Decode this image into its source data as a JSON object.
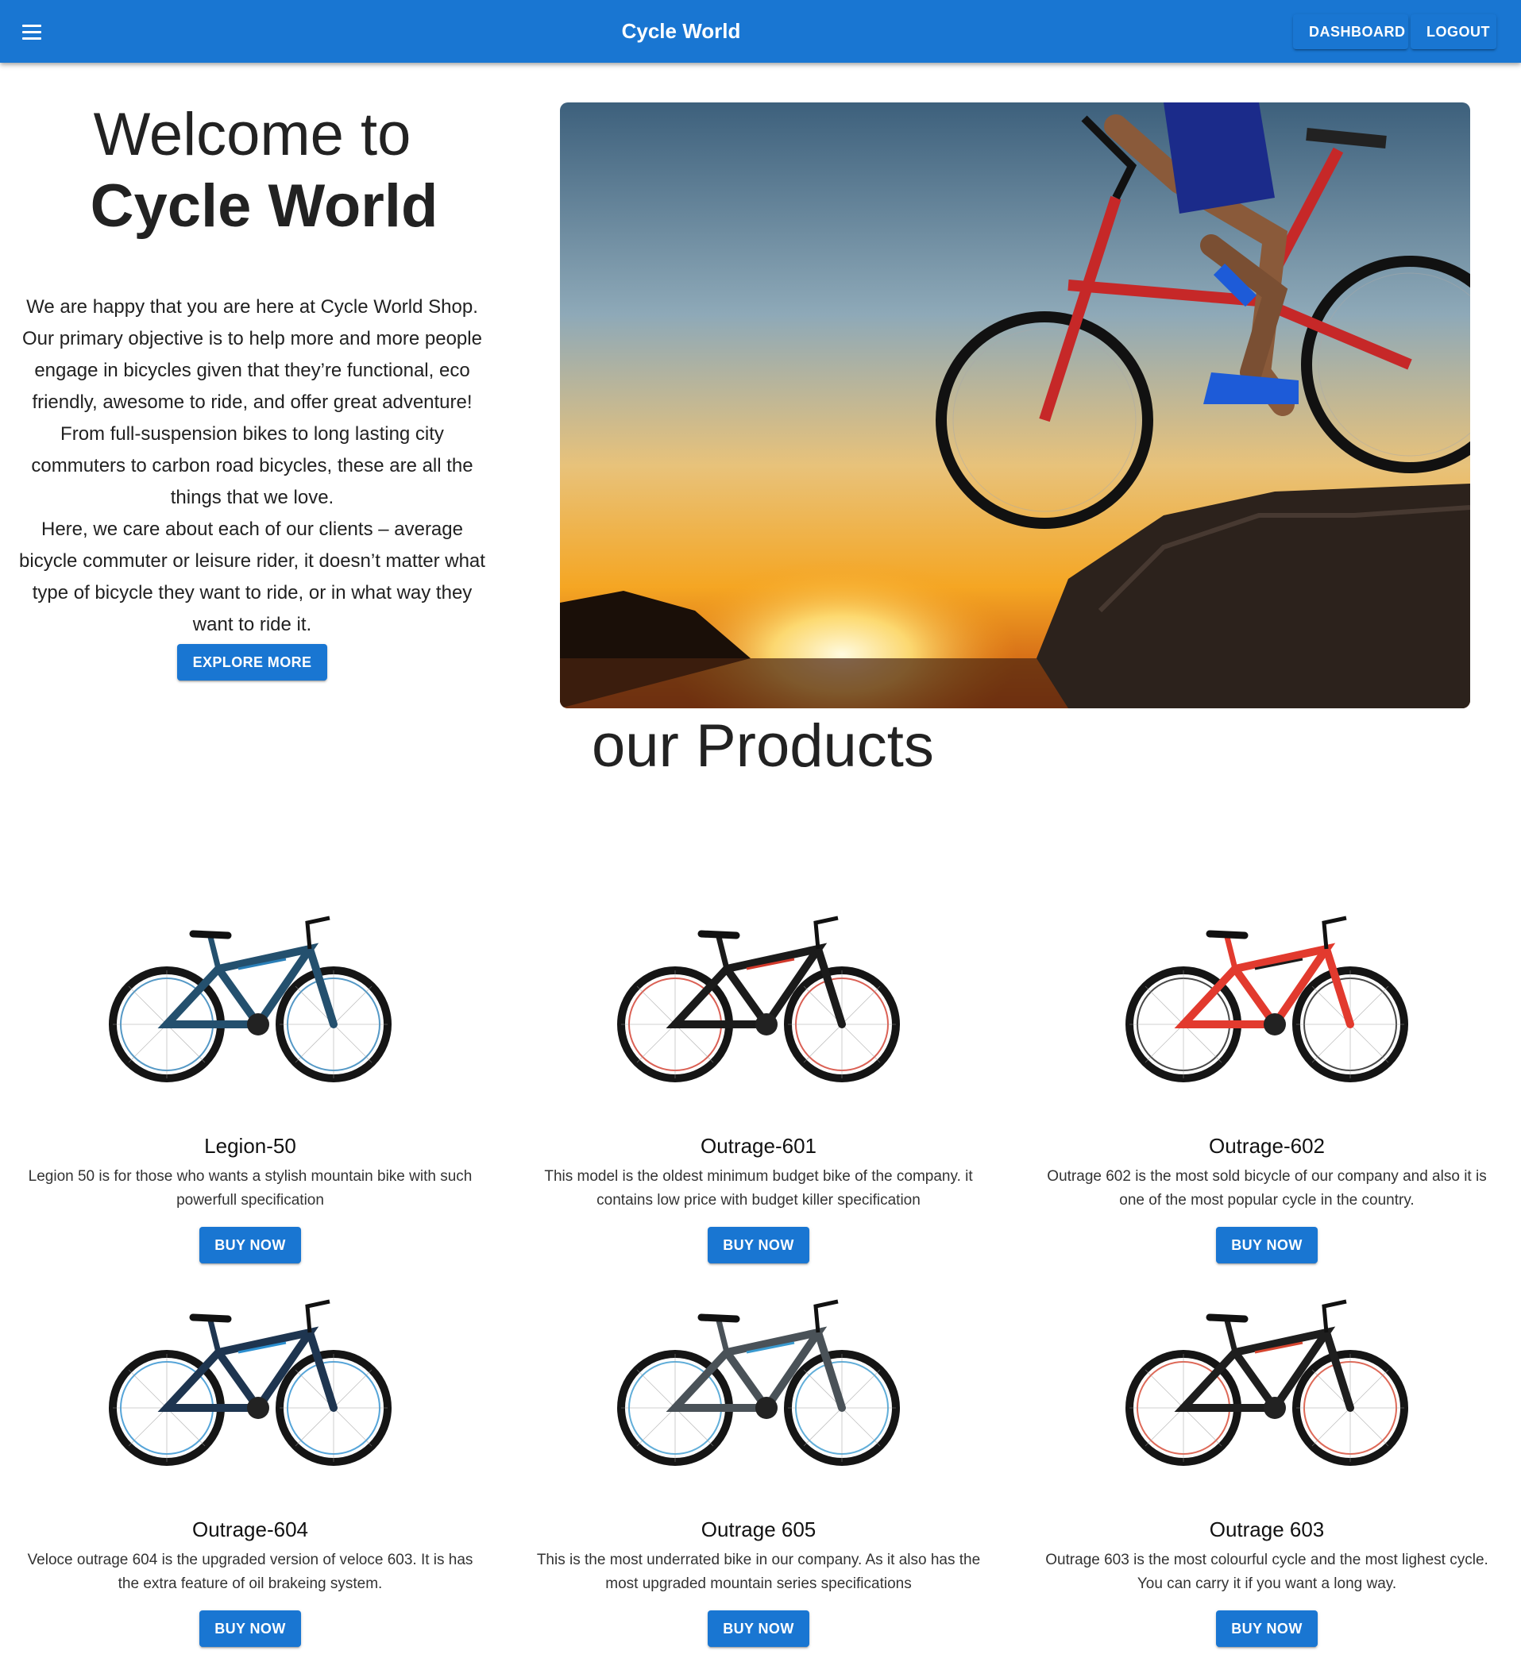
{
  "appbar": {
    "title": "Cycle World",
    "menu_icon": "hamburger-menu-icon",
    "dashboard_label": "DASHBOARD",
    "logout_label": "LOGOUT",
    "color": "#1976d2"
  },
  "hero": {
    "welcome": "Welcome to",
    "brand": "Cycle World",
    "intro": "We are happy that you are here at Cycle World Shop. Our primary objective is to help more and more people engage in bicycles given that they’re functional, eco friendly, awesome to ride, and offer great adventure! From full-suspension bikes to long lasting city commuters to carbon road bicycles, these are all the things that we love.",
    "intro2": "Here, we care about each of our clients – average bicycle commuter or leisure rider, it doesn’t matter what type of bicycle they want to ride, or in what way they want to ride it.",
    "explore_label": "EXPLORE MORE"
  },
  "products_section": {
    "title": "our Products",
    "items": [
      {
        "name": "Legion-50",
        "description": "Legion 50 is for those who wants a stylish mountain bike with such powerfull specification",
        "buy_label": "BUY NOW",
        "frame_color": "#24506e",
        "accent": "#2a7fb8"
      },
      {
        "name": "Outrage-601",
        "description": "This model is the oldest minimum budget bike of the company. it contains low price with budget killer specification",
        "buy_label": "BUY NOW",
        "frame_color": "#1b1b1b",
        "accent": "#d2392b"
      },
      {
        "name": "Outrage-602",
        "description": "Outrage 602 is the most sold bicycle of our company and also it is one of the most popular cycle in the country.",
        "buy_label": "BUY NOW",
        "frame_color": "#e23a2e",
        "accent": "#1b1b1b"
      },
      {
        "name": "Outrage-604",
        "description": "Veloce outrage 604 is the upgraded version of veloce 603. It is has the extra feature of oil brakeing system.",
        "buy_label": "BUY NOW",
        "frame_color": "#1e3550",
        "accent": "#2c8fd0"
      },
      {
        "name": "Outrage 605",
        "description": "This is the most underrated bike in our company. As it also has the most upgraded mountain series specifications",
        "buy_label": "BUY NOW",
        "frame_color": "#4a5258",
        "accent": "#3a9ad0"
      },
      {
        "name": "Outrage 603",
        "description": "Outrage 603 is the most colourful cycle and the most lighest cycle. You can carry it if you want a long way.",
        "buy_label": "BUY NOW",
        "frame_color": "#1e1e1e",
        "accent": "#d6452f"
      }
    ]
  }
}
